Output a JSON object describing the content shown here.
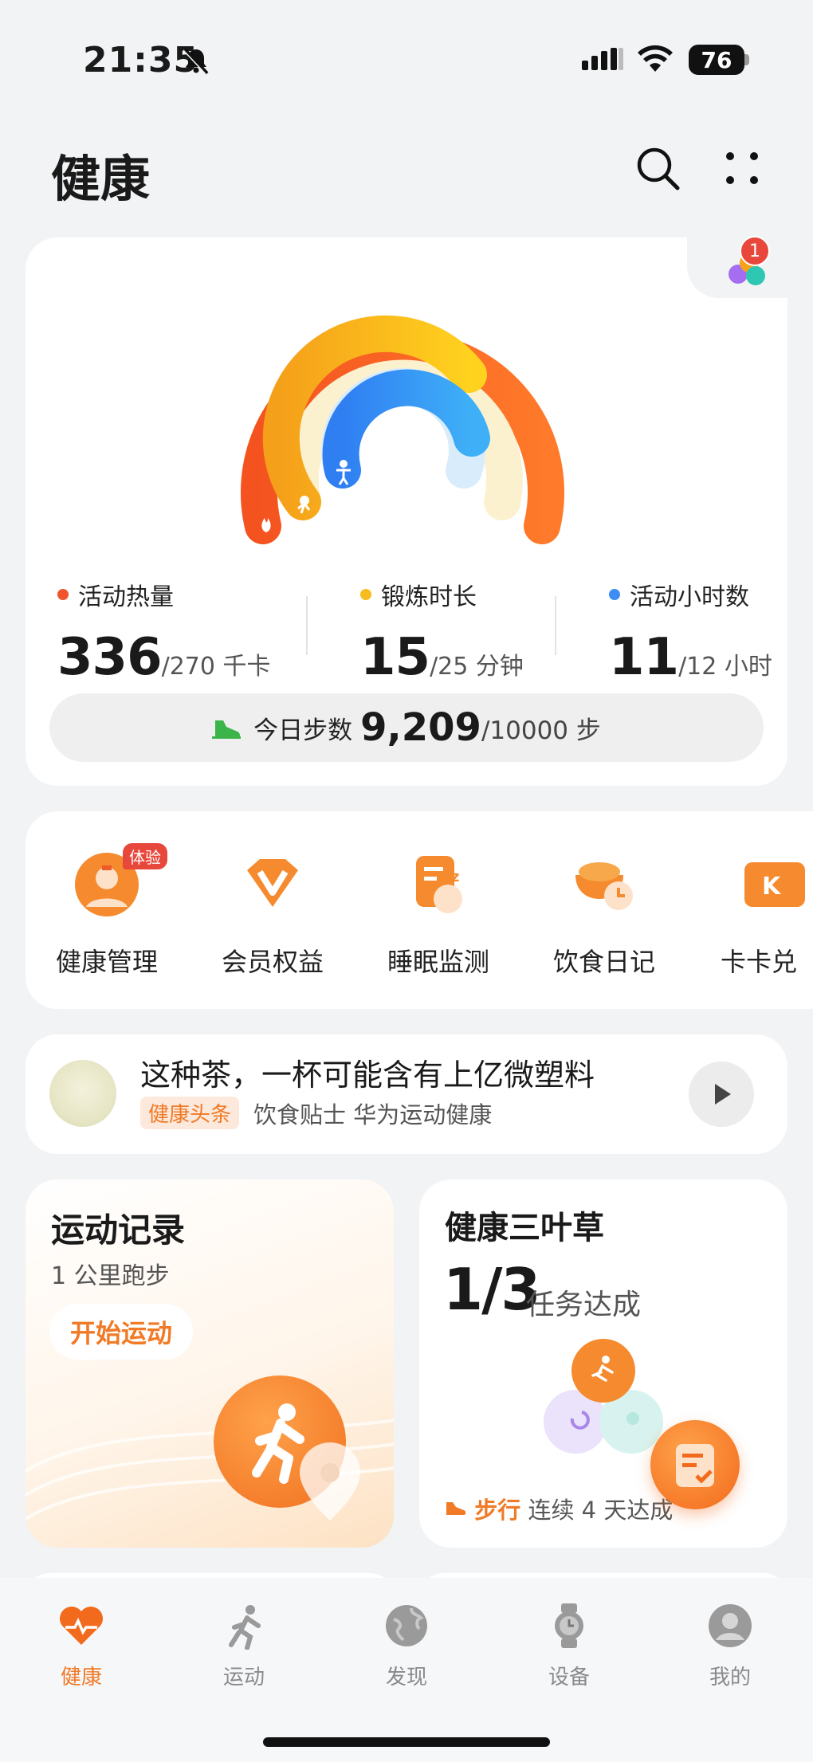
{
  "status_bar": {
    "time": "21:35",
    "battery": "76"
  },
  "header": {
    "title": "健康"
  },
  "rings_card": {
    "badge_count": "1",
    "stats": [
      {
        "label": "活动热量",
        "value": "336",
        "target": "/270 千卡",
        "color": "#f0552b"
      },
      {
        "label": "锻炼时长",
        "value": "15",
        "target": "/25 分钟",
        "color": "#f7bd1e"
      },
      {
        "label": "活动小时数",
        "value": "11",
        "target": "/12 小时",
        "color": "#3d8df5"
      }
    ],
    "steps": {
      "label": "今日步数",
      "value": "9,209",
      "target": "/10000 步"
    }
  },
  "shortcuts": [
    {
      "label": "健康管理",
      "tag": "体验"
    },
    {
      "label": "会员权益"
    },
    {
      "label": "睡眠监测"
    },
    {
      "label": "饮食日记"
    },
    {
      "label": "卡卡兑"
    }
  ],
  "news": {
    "title": "这种茶，一杯可能含有上亿微塑料",
    "tag": "健康头条",
    "source": "饮食贴士 华为运动健康"
  },
  "exercise_card": {
    "title": "运动记录",
    "subtitle": "1 公里跑步",
    "button": "开始运动"
  },
  "clover_card": {
    "title": "健康三叶草",
    "progress": "1/3",
    "progress_label": "任务达成",
    "footer_activity": "步行",
    "footer_text": "连续 4 天达成"
  },
  "tab_bar": [
    {
      "label": "健康",
      "icon": "heart-icon",
      "active": true
    },
    {
      "label": "运动",
      "icon": "run-icon"
    },
    {
      "label": "发现",
      "icon": "globe-icon"
    },
    {
      "label": "设备",
      "icon": "watch-icon"
    },
    {
      "label": "我的",
      "icon": "profile-icon"
    }
  ],
  "colors": {
    "accent": "#f07a26",
    "move": "#f0552b",
    "exercise": "#f7bd1e",
    "stand": "#3d8df5"
  }
}
